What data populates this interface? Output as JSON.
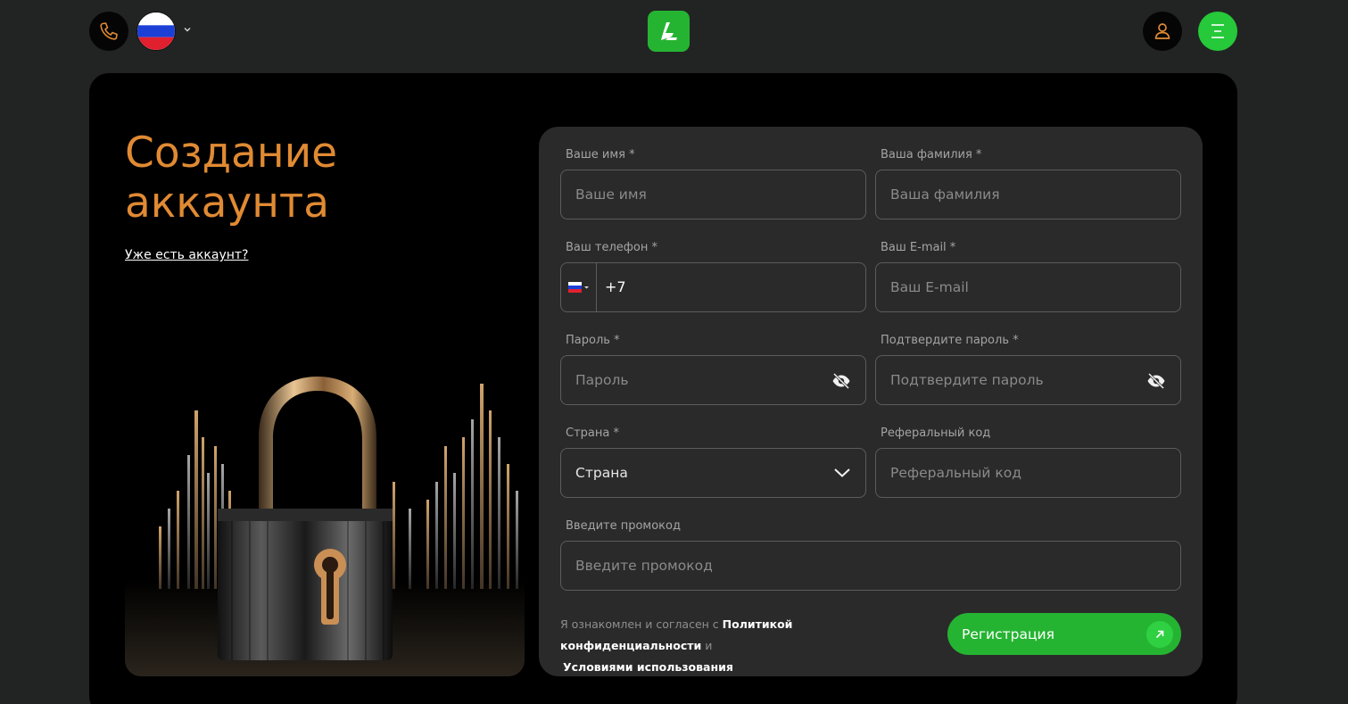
{
  "header": {
    "icons": {
      "phone": "phone-icon",
      "flag": "russia-flag-icon",
      "caret": "chevron-down-icon",
      "logo": "brand-logo-icon",
      "user": "user-icon",
      "menu": "menu-icon"
    },
    "colors": {
      "phone_icon": "#e08a33",
      "logo_bg": "#25b432",
      "menu_bg": "#25c93a"
    }
  },
  "page": {
    "title_line1": "Создание",
    "title_line2": "аккаунта",
    "login_link": "Уже есть аккаунт?",
    "title_color": "#e08a33"
  },
  "form": {
    "first_name": {
      "label": "Ваше имя *",
      "placeholder": "Ваше имя",
      "value": ""
    },
    "last_name": {
      "label": "Ваша фамилия *",
      "placeholder": "Ваша фамилия",
      "value": ""
    },
    "phone": {
      "label": "Ваш телефон *",
      "country_code": "+7",
      "value": "",
      "flag_icon": "russia-flag-icon"
    },
    "email": {
      "label": "Ваш E-mail *",
      "placeholder": "Ваш E-mail",
      "value": ""
    },
    "password": {
      "label": "Пароль *",
      "placeholder": "Пароль",
      "value": "",
      "icon": "eye-off-icon"
    },
    "confirm_password": {
      "label": "Подтвердите пароль *",
      "placeholder": "Подтвердите пароль",
      "value": "",
      "icon": "eye-off-icon"
    },
    "country": {
      "label": "Страна *",
      "selected": "Страна",
      "icon": "chevron-down-icon"
    },
    "referral": {
      "label": "Реферальный код",
      "placeholder": "Реферальный код",
      "value": ""
    },
    "promo": {
      "label": "Введите промокод",
      "placeholder": "Введите промокод",
      "value": ""
    },
    "consent": {
      "prefix": "Я ознакомлен и согласен с ",
      "privacy_link": "Политикой конфиденциальности",
      "joiner": " и ",
      "terms_link": "Условиями использования"
    },
    "submit": {
      "label": "Регистрация",
      "icon": "arrow-up-right-icon",
      "color": "#25b432"
    }
  }
}
